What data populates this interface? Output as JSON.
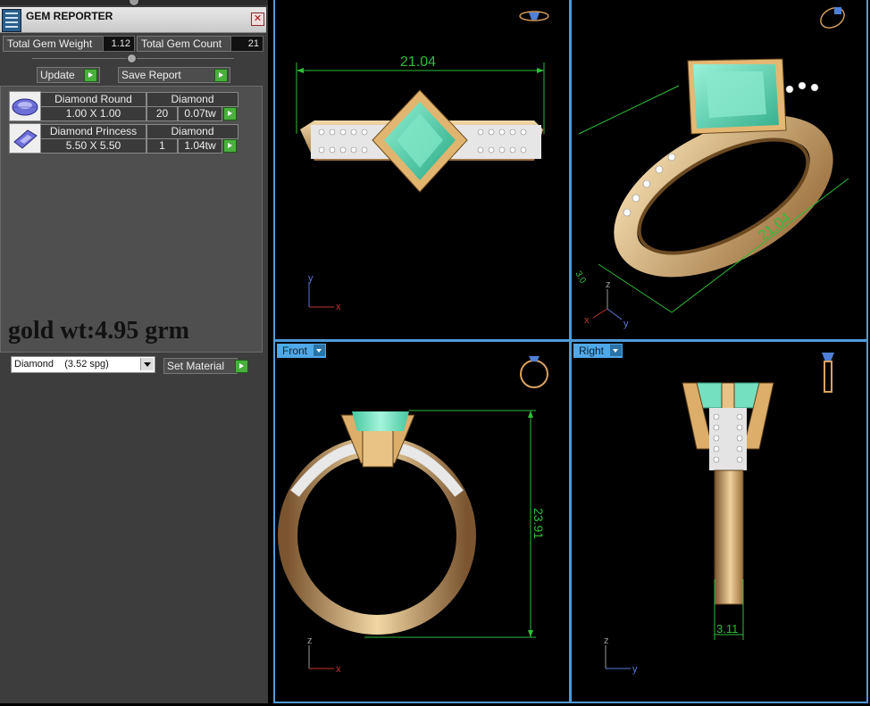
{
  "panel": {
    "title": "GEM REPORTER",
    "close_label": "✕",
    "total_gem_weight_label": "Total Gem Weight",
    "total_gem_weight_value": "1.12",
    "total_gem_count_label": "Total Gem Count",
    "total_gem_count_value": "21",
    "update_label": "Update",
    "save_report_label": "Save Report",
    "gems": [
      {
        "name": "Diamond Round",
        "material": "Diamond",
        "size": "1.00 X 1.00",
        "count": "20",
        "weight": "0.07tw",
        "icon": "round-gem-icon"
      },
      {
        "name": "Diamond Princess",
        "material": "Diamond",
        "size": "5.50 X 5.50",
        "count": "1",
        "weight": "1.04tw",
        "icon": "princess-gem-icon"
      }
    ],
    "note": "gold wt:4.95 grm",
    "material_select": {
      "name": "Diamond",
      "spg": "(3.52 spg)"
    },
    "set_material_label": "Set Material"
  },
  "viewports": {
    "top": {
      "dimension": "21.04",
      "axes": [
        "y",
        "x"
      ]
    },
    "perspective": {
      "dimension": "21.04",
      "side_label": "3.0",
      "axes": [
        "z",
        "x",
        "y"
      ]
    },
    "front": {
      "tab": "Front",
      "dimension": "23.91",
      "axes": [
        "z",
        "x"
      ]
    },
    "right": {
      "tab": "Right",
      "dimension": "3.11",
      "axes": [
        "z",
        "y"
      ]
    }
  },
  "colors": {
    "panel_bg": "#3d3d3d",
    "viewport_border": "#4e9bd8",
    "dimension_green": "#2ebd3a",
    "gold": "#d9b07a",
    "emerald": "#4fd3b0",
    "go_button": "#49b03c"
  }
}
